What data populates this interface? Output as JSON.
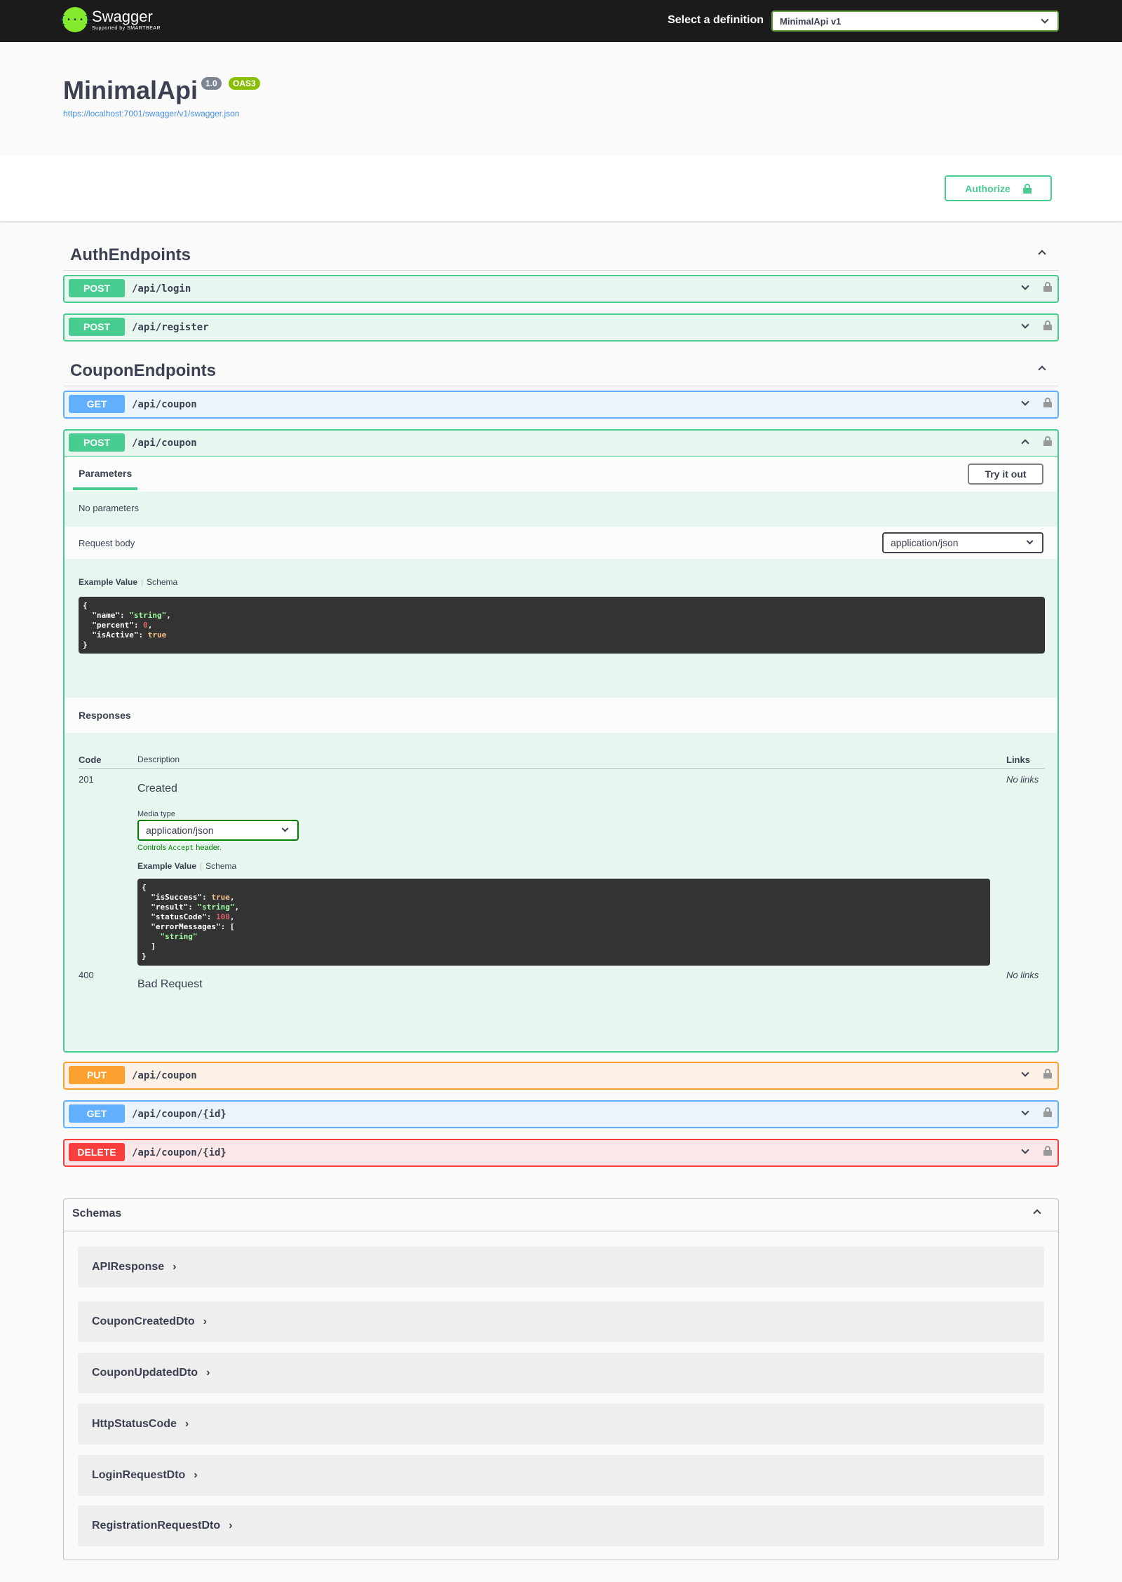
{
  "topbar": {
    "logo_name": "Swagger",
    "logo_sub": "Supported by SMARTBEAR",
    "select_label": "Select a definition",
    "selected_definition": "MinimalApi v1"
  },
  "info": {
    "title": "MinimalApi",
    "version": "1.0",
    "oas": "OAS3",
    "url": "https://localhost:7001/swagger/v1/swagger.json"
  },
  "authorize_label": "Authorize",
  "tags": [
    {
      "name": "AuthEndpoints"
    },
    {
      "name": "CouponEndpoints"
    }
  ],
  "ops": [
    {
      "method": "POST",
      "path": "/api/login"
    },
    {
      "method": "POST",
      "path": "/api/register"
    },
    {
      "method": "GET",
      "path": "/api/coupon"
    },
    {
      "method": "POST",
      "path": "/api/coupon"
    },
    {
      "method": "PUT",
      "path": "/api/coupon"
    },
    {
      "method": "GET",
      "path": "/api/coupon/{id}"
    },
    {
      "method": "DELETE",
      "path": "/api/coupon/{id}"
    }
  ],
  "expanded": {
    "params_tab": "Parameters",
    "try_label": "Try it out",
    "no_params": "No parameters",
    "request_body": "Request body",
    "content_type": "application/json",
    "example_value": "Example Value",
    "schema": "Schema",
    "responses": "Responses",
    "col_code": "Code",
    "col_description": "Description",
    "col_links": "Links",
    "r201_code": "201",
    "r201_desc": "Created",
    "no_links": "No links",
    "media_type_label": "Media type",
    "media_type": "application/json",
    "controls_pre": "Controls",
    "controls_code": "Accept",
    "controls_post": "header.",
    "r400_code": "400",
    "r400_desc": "Bad Request"
  },
  "schemas": {
    "title": "Schemas",
    "models": [
      "APIResponse",
      "CouponCreatedDto",
      "CouponUpdatedDto",
      "HttpStatusCode",
      "LoginRequestDto",
      "RegistrationRequestDto"
    ]
  },
  "colors": {
    "post": "#49cc90",
    "get": "#61affe",
    "put": "#fca130",
    "delete": "#f93e3e",
    "topbar": "#1b1b1b",
    "logo": "#85ea2d"
  },
  "icons": [
    "swagger-logo-icon",
    "chevron-down-icon",
    "chevron-up-icon",
    "lock-icon"
  ]
}
